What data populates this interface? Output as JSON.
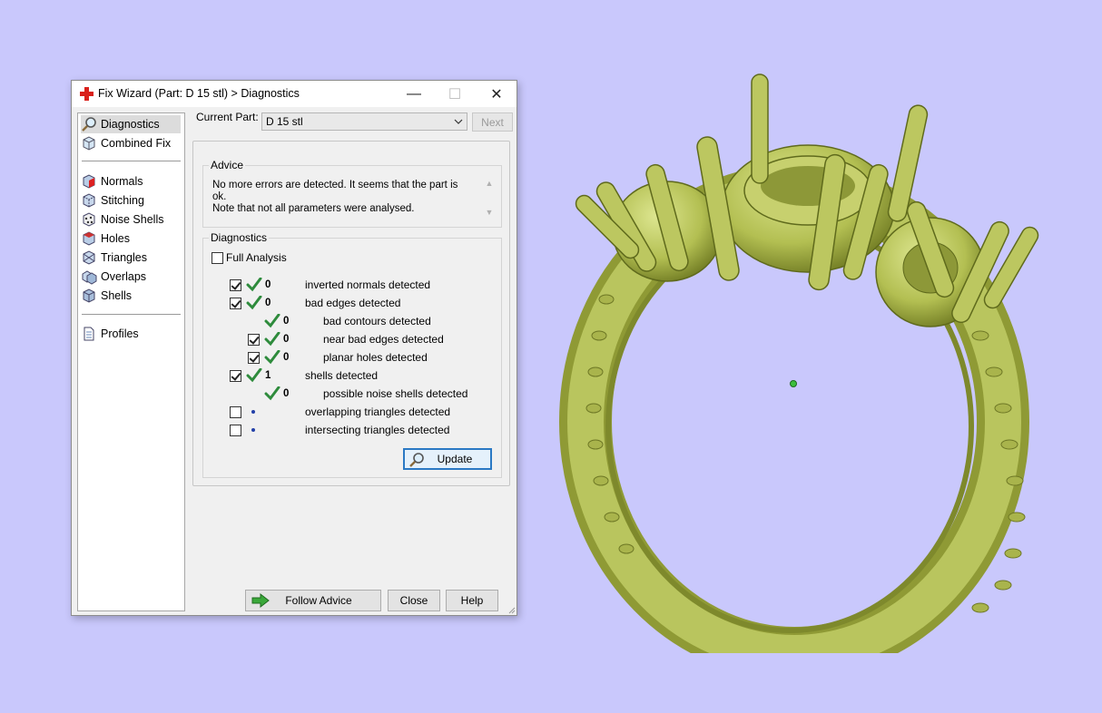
{
  "window": {
    "title": "Fix Wizard (Part: D 15 stl) > Diagnostics",
    "minimize": "—",
    "maximize": "☐",
    "close": "✕"
  },
  "sidebar": {
    "items": [
      {
        "label": "Diagnostics",
        "icon": "magnifier-icon"
      },
      {
        "label": "Combined Fix",
        "icon": "cube-icon"
      },
      {
        "label": "Normals",
        "icon": "normals-cube-icon"
      },
      {
        "label": "Stitching",
        "icon": "stitching-cube-icon"
      },
      {
        "label": "Noise Shells",
        "icon": "noise-shells-icon"
      },
      {
        "label": "Holes",
        "icon": "holes-cube-icon"
      },
      {
        "label": "Triangles",
        "icon": "triangles-cube-icon"
      },
      {
        "label": "Overlaps",
        "icon": "overlaps-icon"
      },
      {
        "label": "Shells",
        "icon": "shells-cube-icon"
      },
      {
        "label": "Profiles",
        "icon": "document-icon"
      }
    ]
  },
  "current_part": {
    "label": "Current Part:",
    "value": "D 15 stl",
    "next_label": "Next"
  },
  "advice": {
    "title": "Advice",
    "line1": "No more errors are detected. It seems that the part is ok.",
    "line2": "Note that not all parameters were analysed."
  },
  "diagnostics": {
    "title": "Diagnostics",
    "full_analysis_label": "Full Analysis",
    "full_analysis_checked": false,
    "rows": [
      {
        "checked": true,
        "count": "0",
        "label": "inverted normals detected"
      },
      {
        "checked": true,
        "count": "0",
        "label": "bad edges detected"
      },
      {
        "checked": null,
        "count": "0",
        "label": "bad contours detected"
      },
      {
        "checked": true,
        "count": "0",
        "label": "near bad edges detected"
      },
      {
        "checked": true,
        "count": "0",
        "label": "planar holes detected"
      },
      {
        "checked": true,
        "count": "1",
        "label": "shells detected"
      },
      {
        "checked": null,
        "count": "0",
        "label": "possible noise shells detected"
      },
      {
        "checked": false,
        "count": "",
        "label": "overlapping triangles detected"
      },
      {
        "checked": false,
        "count": "",
        "label": "intersecting triangles detected"
      }
    ],
    "update_label": "Update"
  },
  "buttons": {
    "follow_advice": "Follow Advice",
    "close": "Close",
    "help": "Help"
  },
  "colors": {
    "background": "#c9c8fc",
    "ring": "#b5c15a",
    "check_green": "#2e8b3c"
  }
}
